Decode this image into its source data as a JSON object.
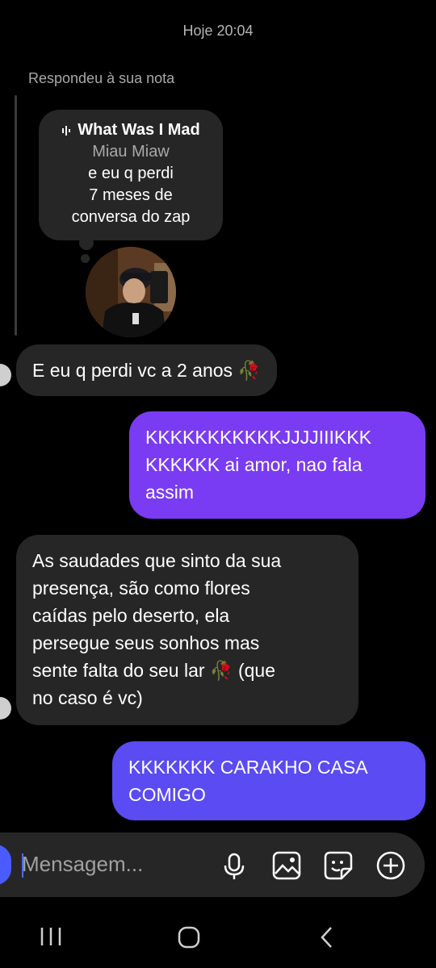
{
  "timestamp": "Hoje 20:04",
  "reply_label": "Respondeu à sua nota",
  "note": {
    "song": "What Was I Mad",
    "artist": "Miau Miaw",
    "lines": [
      "e eu q perdi",
      "7 meses de",
      "conversa do zap"
    ]
  },
  "messages": [
    {
      "direction": "in",
      "text": "E eu q perdi vc a 2 anos",
      "emoji": "🥀"
    },
    {
      "direction": "out",
      "lines": [
        "KKKKKKKKKKKJJJJIIIKKK",
        "KKKKKK ai amor, nao fala",
        "assim"
      ]
    },
    {
      "direction": "in",
      "lines": [
        "As saudades que sinto da sua",
        "presença, são como flores",
        "caídas pelo deserto, ela",
        "persegue seus sonhos mas",
        "sente falta do seu lar",
        "no caso é vc)"
      ],
      "emoji": "🥀",
      "after_emoji": "(que"
    },
    {
      "direction": "out",
      "lines": [
        "KKKKKKK CARAKHO CASA",
        "COMIGO"
      ]
    }
  ],
  "composer": {
    "placeholder": "Mensagem..."
  },
  "icons": [
    "camera-icon",
    "microphone-icon",
    "gallery-icon",
    "sticker-icon",
    "add-icon",
    "recent-apps-icon",
    "home-icon",
    "back-icon"
  ],
  "colors": {
    "incoming": "#262626",
    "outgoing_1": "#7a3cf2",
    "outgoing_2": "#5b4bf3",
    "accent": "#4a5bff"
  }
}
